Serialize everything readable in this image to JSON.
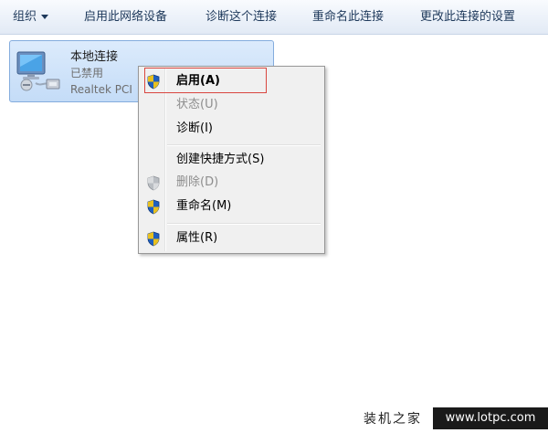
{
  "toolbar": {
    "organize": "组织",
    "enable_device": "启用此网络设备",
    "diagnose": "诊断这个连接",
    "rename": "重命名此连接",
    "change_settings": "更改此连接的设置"
  },
  "connection": {
    "name": "本地连接",
    "status": "已禁用",
    "adapter": "Realtek PCI"
  },
  "context_menu": {
    "items": [
      {
        "label": "启用(A)",
        "icon": "shield-icon",
        "disabled": false,
        "bold": true
      },
      {
        "label": "状态(U)",
        "icon": "",
        "disabled": true,
        "bold": false
      },
      {
        "label": "诊断(I)",
        "icon": "",
        "disabled": false,
        "bold": false
      },
      {
        "label": "创建快捷方式(S)",
        "icon": "",
        "disabled": false,
        "bold": false
      },
      {
        "label": "删除(D)",
        "icon": "shield-icon",
        "disabled": true,
        "bold": false
      },
      {
        "label": "重命名(M)",
        "icon": "shield-icon",
        "disabled": false,
        "bold": false
      },
      {
        "label": "属性(R)",
        "icon": "shield-icon",
        "disabled": false,
        "bold": false
      }
    ]
  },
  "watermark": {
    "brand": "装机之家",
    "url": "www.lotpc.com"
  },
  "colors": {
    "highlight_border": "#d9463f",
    "tile_border": "#84acdd",
    "menu_background": "#f0f0f0"
  }
}
